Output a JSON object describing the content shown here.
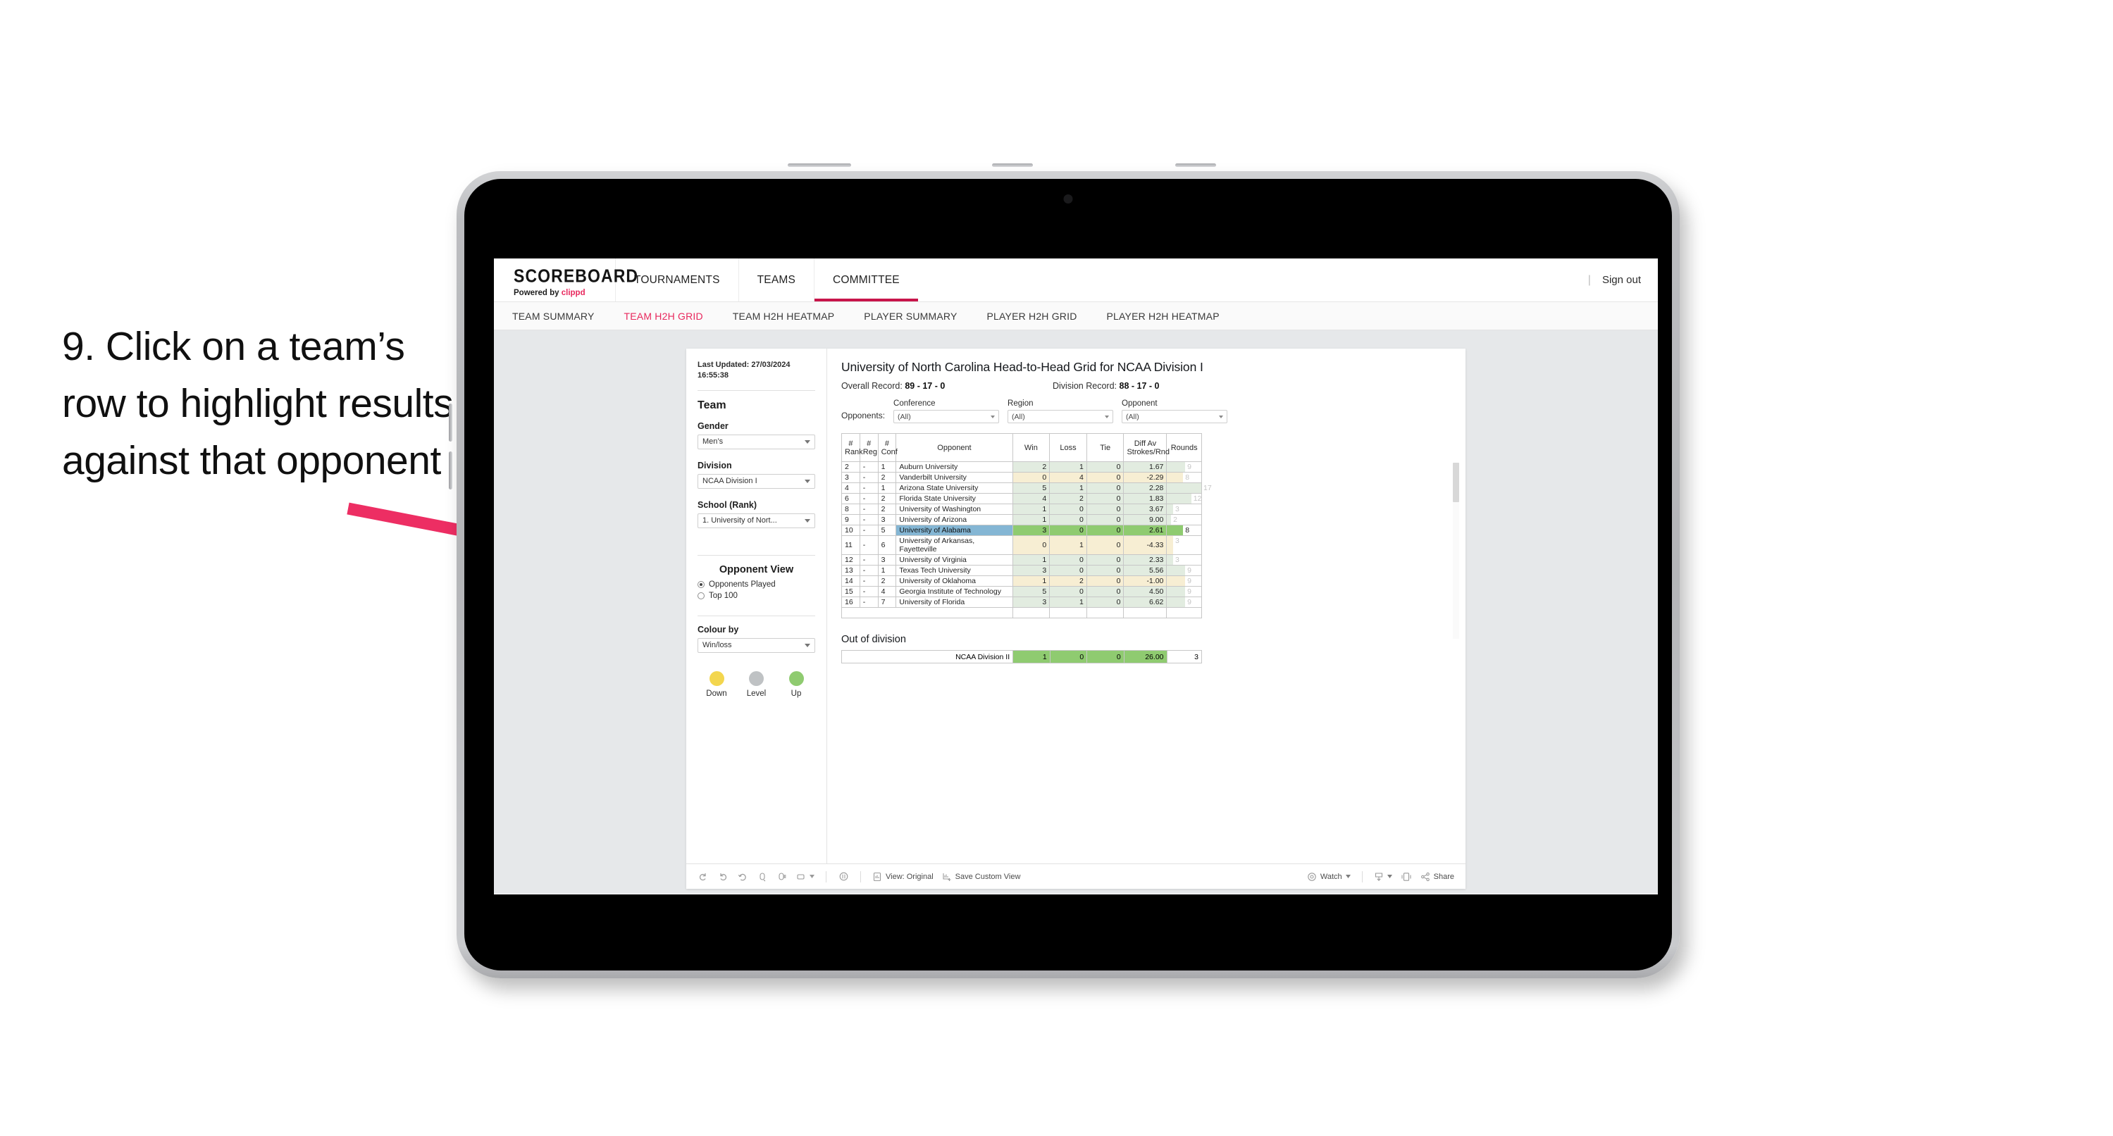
{
  "caption": "9. Click on a team’s row to highlight results against that opponent",
  "app": {
    "brand": {
      "title": "SCOREBOARD",
      "powered_prefix": "Powered by ",
      "powered_name": "clippd"
    },
    "nav": [
      {
        "label": "TOURNAMENTS",
        "active": false
      },
      {
        "label": "TEAMS",
        "active": false
      },
      {
        "label": "COMMITTEE",
        "active": true
      }
    ],
    "signout": "Sign out",
    "subnav": [
      {
        "label": "TEAM SUMMARY",
        "active": false
      },
      {
        "label": "TEAM H2H GRID",
        "active": true
      },
      {
        "label": "TEAM H2H HEATMAP",
        "active": false
      },
      {
        "label": "PLAYER SUMMARY",
        "active": false
      },
      {
        "label": "PLAYER H2H GRID",
        "active": false
      },
      {
        "label": "PLAYER H2H HEATMAP",
        "active": false
      }
    ]
  },
  "sidebar": {
    "last_updated": "Last Updated: 27/03/2024 16:55:38",
    "team_heading": "Team",
    "gender_label": "Gender",
    "gender_value": "Men’s",
    "division_label": "Division",
    "division_value": "NCAA Division I",
    "school_label": "School (Rank)",
    "school_value": "1. University of Nort...",
    "opponent_view_heading": "Opponent View",
    "opponent_view_options": [
      {
        "label": "Opponents Played",
        "selected": true
      },
      {
        "label": "Top 100",
        "selected": false
      }
    ],
    "colour_by_label": "Colour by",
    "colour_by_value": "Win/loss",
    "legend": [
      {
        "label": "Down",
        "color": "#f3d64e"
      },
      {
        "label": "Level",
        "color": "#bfc2c4"
      },
      {
        "label": "Up",
        "color": "#8fcb70"
      }
    ]
  },
  "main": {
    "title": "University of North Carolina Head-to-Head Grid for NCAA Division I",
    "overall_record_label": "Overall Record:",
    "overall_record_value": "89 - 17 - 0",
    "division_record_label": "Division Record:",
    "division_record_value": "88 - 17 - 0",
    "opponents_label": "Opponents:",
    "filters": [
      {
        "title": "Conference",
        "value": "(All)"
      },
      {
        "title": "Region",
        "value": "(All)"
      },
      {
        "title": "Opponent",
        "value": "(All)"
      }
    ],
    "columns": [
      "# Rank",
      "# Reg",
      "# Conf",
      "Opponent",
      "Win",
      "Loss",
      "Tie",
      "Diff Av Strokes/Rnd",
      "Rounds"
    ],
    "columns_split": [
      [
        "#",
        "Rank"
      ],
      [
        "#",
        "Reg"
      ],
      [
        "#",
        "Conf"
      ],
      [
        "Opponent",
        ""
      ],
      [
        "Win",
        ""
      ],
      [
        "Loss",
        ""
      ],
      [
        "Tie",
        ""
      ],
      [
        "Diff Av",
        "Strokes/Rnd"
      ],
      [
        "Rounds",
        ""
      ]
    ],
    "rows": [
      {
        "rank": "2",
        "reg": "-",
        "conf": "1",
        "opponent": "Auburn University",
        "win": "2",
        "loss": "1",
        "tie": "0",
        "diff": "1.67",
        "rounds": "9",
        "state": "up"
      },
      {
        "rank": "3",
        "reg": "-",
        "conf": "2",
        "opponent": "Vanderbilt University",
        "win": "0",
        "loss": "4",
        "tie": "0",
        "diff": "-2.29",
        "rounds": "8",
        "state": "down"
      },
      {
        "rank": "4",
        "reg": "-",
        "conf": "1",
        "opponent": "Arizona State University",
        "win": "5",
        "loss": "1",
        "tie": "0",
        "diff": "2.28",
        "rounds": "17",
        "state": "up"
      },
      {
        "rank": "6",
        "reg": "-",
        "conf": "2",
        "opponent": "Florida State University",
        "win": "4",
        "loss": "2",
        "tie": "0",
        "diff": "1.83",
        "rounds": "12",
        "state": "up"
      },
      {
        "rank": "8",
        "reg": "-",
        "conf": "2",
        "opponent": "University of Washington",
        "win": "1",
        "loss": "0",
        "tie": "0",
        "diff": "3.67",
        "rounds": "3",
        "state": "up"
      },
      {
        "rank": "9",
        "reg": "-",
        "conf": "3",
        "opponent": "University of Arizona",
        "win": "1",
        "loss": "0",
        "tie": "0",
        "diff": "9.00",
        "rounds": "2",
        "state": "up"
      },
      {
        "rank": "10",
        "reg": "-",
        "conf": "5",
        "opponent": "University of Alabama",
        "win": "3",
        "loss": "0",
        "tie": "0",
        "diff": "2.61",
        "rounds": "8",
        "state": "selected"
      },
      {
        "rank": "11",
        "reg": "-",
        "conf": "6",
        "opponent": "University of Arkansas, Fayetteville",
        "win": "0",
        "loss": "1",
        "tie": "0",
        "diff": "-4.33",
        "rounds": "3",
        "state": "down"
      },
      {
        "rank": "12",
        "reg": "-",
        "conf": "3",
        "opponent": "University of Virginia",
        "win": "1",
        "loss": "0",
        "tie": "0",
        "diff": "2.33",
        "rounds": "3",
        "state": "up"
      },
      {
        "rank": "13",
        "reg": "-",
        "conf": "1",
        "opponent": "Texas Tech University",
        "win": "3",
        "loss": "0",
        "tie": "0",
        "diff": "5.56",
        "rounds": "9",
        "state": "up"
      },
      {
        "rank": "14",
        "reg": "-",
        "conf": "2",
        "opponent": "University of Oklahoma",
        "win": "1",
        "loss": "2",
        "tie": "0",
        "diff": "-1.00",
        "rounds": "9",
        "state": "down"
      },
      {
        "rank": "15",
        "reg": "-",
        "conf": "4",
        "opponent": "Georgia Institute of Technology",
        "win": "5",
        "loss": "0",
        "tie": "0",
        "diff": "4.50",
        "rounds": "9",
        "state": "up"
      },
      {
        "rank": "16",
        "reg": "-",
        "conf": "7",
        "opponent": "University of Florida",
        "win": "3",
        "loss": "1",
        "tie": "0",
        "diff": "6.62",
        "rounds": "9",
        "state": "up"
      }
    ],
    "out_of_division_title": "Out of division",
    "out_of_division_row": {
      "label": "NCAA Division II",
      "win": "1",
      "loss": "0",
      "tie": "0",
      "diff": "26.00",
      "rounds": "3"
    }
  },
  "toolbar": {
    "view_label": "View: Original",
    "save_label": "Save Custom View",
    "watch_label": "Watch",
    "share_label": "Share"
  },
  "colors": {
    "accent": "#e8285d",
    "up": "#8fcb70",
    "down": "#f3d64e",
    "level": "#bfc2c4",
    "selected_row": "#84b6d4",
    "arrow": "#ed2e63"
  }
}
